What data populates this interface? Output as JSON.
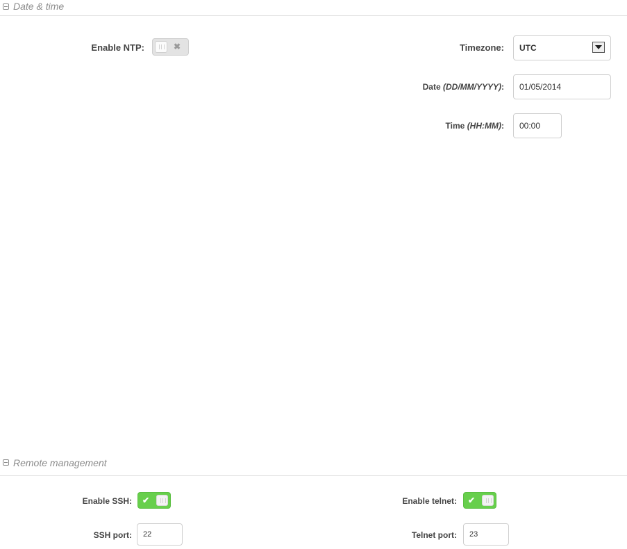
{
  "date_time_section": {
    "title": "Date & time",
    "ntp": {
      "label": "Enable NTP:",
      "enabled": false
    },
    "timezone": {
      "label": "Timezone:",
      "value": "UTC"
    },
    "date": {
      "label_prefix": "Date",
      "label_format": "(DD/MM/YYYY)",
      "label_suffix": ":",
      "value": "01/05/2014"
    },
    "time": {
      "label_prefix": "Time",
      "label_format": "(HH:MM)",
      "label_suffix": ":",
      "value": "00:00"
    }
  },
  "remote_management_section": {
    "title": "Remote management",
    "ssh": {
      "label": "Enable SSH:",
      "enabled": true
    },
    "telnet": {
      "label": "Enable telnet:",
      "enabled": true
    },
    "ssh_port": {
      "label": "SSH port:",
      "value": "22"
    },
    "telnet_port": {
      "label": "Telnet port:",
      "value": "23"
    }
  },
  "icons": {
    "collapse": "collapse-icon",
    "toggle_off_mark": "✖",
    "toggle_on_mark": "✔"
  },
  "colors": {
    "toggle_on": "#67cf4c",
    "toggle_off": "#e3e3e3",
    "section_title": "#8b8b8b"
  }
}
